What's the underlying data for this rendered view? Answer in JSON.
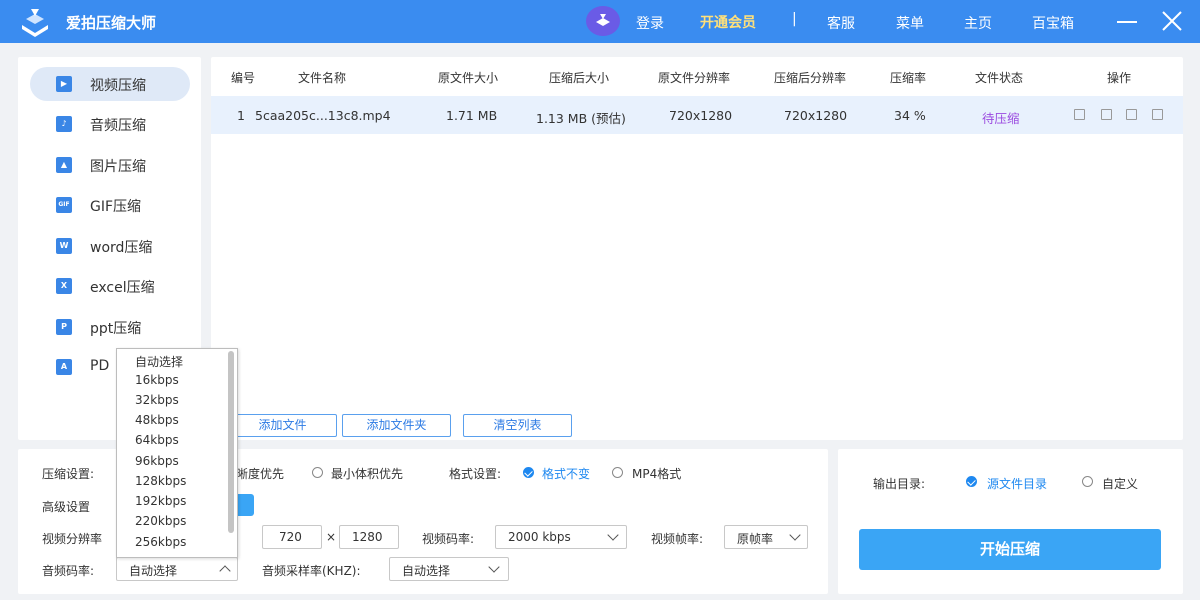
{
  "app": {
    "title": "爱拍压缩大师",
    "login": "登录",
    "vip": "开通会员",
    "sep": "|",
    "service": "客服",
    "menu": "菜单",
    "home": "主页",
    "toolbox": "百宝箱"
  },
  "sidebar": {
    "items": [
      {
        "label": "视频压缩",
        "icon": "video-file-icon"
      },
      {
        "label": "音频压缩",
        "icon": "audio-file-icon"
      },
      {
        "label": "图片压缩",
        "icon": "image-file-icon"
      },
      {
        "label": "GIF压缩",
        "icon": "gif-file-icon",
        "glyph": "GIF"
      },
      {
        "label": "word压缩",
        "icon": "word-file-icon",
        "glyph": "W"
      },
      {
        "label": "excel压缩",
        "icon": "excel-file-icon",
        "glyph": "X"
      },
      {
        "label": "ppt压缩",
        "icon": "ppt-file-icon",
        "glyph": "P"
      },
      {
        "label": "PD",
        "icon": "pdf-file-icon",
        "glyph": "A"
      }
    ]
  },
  "table": {
    "headers": [
      "编号",
      "文件名称",
      "原文件大小",
      "压缩后大小",
      "原文件分辨率",
      "压缩后分辨率",
      "压缩率",
      "文件状态",
      "操作"
    ],
    "rows": [
      {
        "num": "1",
        "name": "5caa205c...13c8.mp4",
        "orig_size": "1.71 MB",
        "comp_size": "1.13 MB (预估)",
        "orig_res": "720x1280",
        "comp_res": "720x1280",
        "ratio": "34 %",
        "status": "待压缩"
      }
    ]
  },
  "file_buttons": {
    "add_file": "添加文件",
    "add_folder": "添加文件夹",
    "clear_list": "清空列表"
  },
  "settings": {
    "compress_label": "压缩设置:",
    "clarity_first": "晰度优先",
    "min_size_first": "最小体积优先",
    "format_label": "格式设置:",
    "format_keep": "格式不变",
    "format_mp4": "MP4格式",
    "advanced_label": "高级设置",
    "video_res_label": "视频分辨率",
    "res_w": "720",
    "res_x": "×",
    "res_h": "1280",
    "video_bitrate_label": "视频码率:",
    "video_bitrate": "2000 kbps",
    "frame_rate_label": "视频帧率:",
    "frame_rate": "原帧率",
    "audio_bitrate_label": "音频码率:",
    "audio_bitrate": "自动选择",
    "sample_rate_label": "音频采样率(KHZ):",
    "sample_rate": "自动选择"
  },
  "dropdown": {
    "options": [
      "自动选择",
      "16kbps",
      "32kbps",
      "48kbps",
      "64kbps",
      "96kbps",
      "128kbps",
      "192kbps",
      "220kbps",
      "256kbps"
    ]
  },
  "output": {
    "label": "输出目录:",
    "source_dir": "源文件目录",
    "custom": "自定义",
    "start": "开始压缩"
  },
  "colors": {
    "titlebar": "#3a8cf0",
    "accent": "#1e88f0",
    "status": "#9b4be0",
    "start_button": "#3aa5f5"
  }
}
